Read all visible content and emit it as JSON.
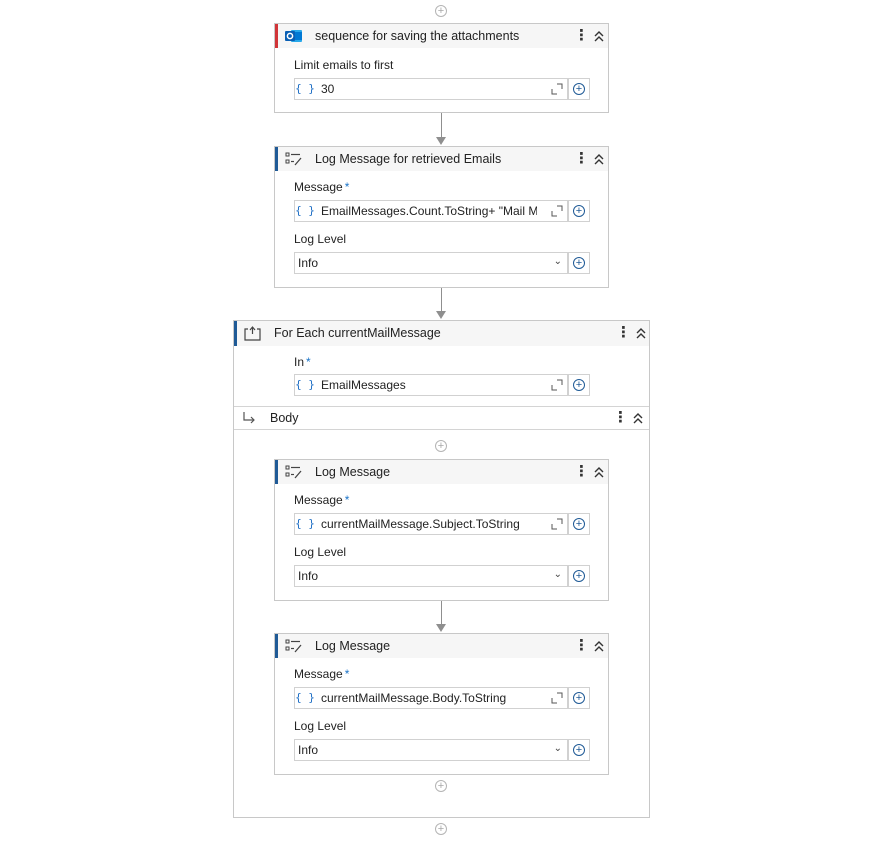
{
  "sequence_card": {
    "title": "sequence for saving the attachments",
    "icon": "outlook-icon",
    "field_label": "Limit emails to first",
    "field_value": "30"
  },
  "log_card_1": {
    "title": "Log Message for retrieved Emails",
    "icon": "log-message-icon",
    "message_label": "Message",
    "required_mark": "*",
    "message_value": "EmailMessages.Count.ToString+ \"Mail Mes",
    "level_label": "Log Level",
    "level_value": "Info"
  },
  "foreach": {
    "title": "For Each currentMailMessage",
    "icon": "for-each-icon",
    "in_label": "In",
    "required_mark": "*",
    "in_value": "EmailMessages",
    "body_label": "Body"
  },
  "log_card_2": {
    "title": "Log Message",
    "message_label": "Message",
    "required_mark": "*",
    "message_value": "currentMailMessage.Subject.ToString",
    "level_label": "Log Level",
    "level_value": "Info"
  },
  "log_card_3": {
    "title": "Log Message",
    "message_label": "Message",
    "required_mark": "*",
    "message_value": "currentMailMessage.Body.ToString",
    "level_label": "Log Level",
    "level_value": "Info"
  },
  "symbols": {
    "brace": "{ }",
    "kebab": "⋮",
    "plus": "+",
    "caret": "⌄"
  },
  "colors": {
    "accent": "#1f5a96",
    "error_accent": "#d13438",
    "expression_blue": "#1f6fc5"
  }
}
